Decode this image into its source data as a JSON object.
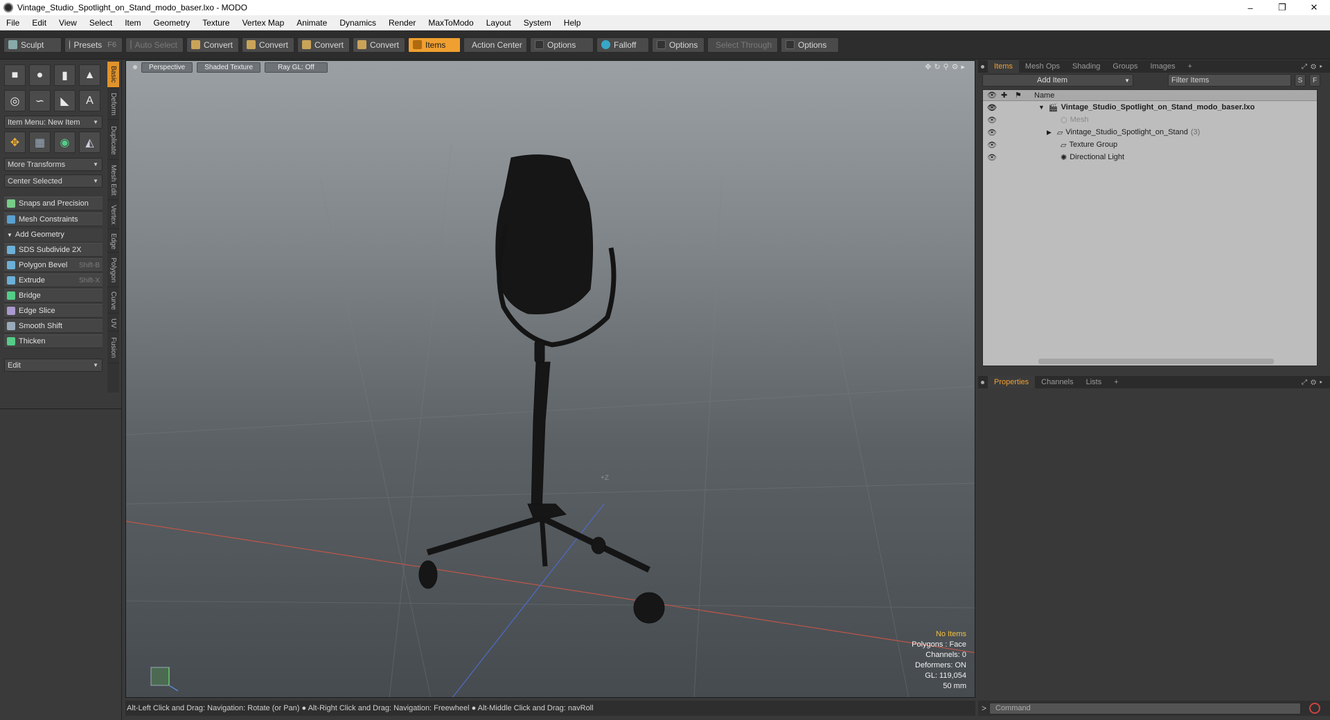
{
  "window": {
    "title": "Vintage_Studio_Spotlight_on_Stand_modo_baser.lxo - MODO",
    "controls": [
      "–",
      "❐",
      "✕"
    ]
  },
  "menu": [
    "File",
    "Edit",
    "View",
    "Select",
    "Item",
    "Geometry",
    "Texture",
    "Vertex Map",
    "Animate",
    "Dynamics",
    "Render",
    "MaxToModo",
    "Layout",
    "System",
    "Help"
  ],
  "toolbar": {
    "sculpt": "Sculpt",
    "presets": "Presets",
    "presets_key": "F6",
    "auto_select": "Auto Select",
    "convert1": "Convert",
    "convert2": "Convert",
    "convert3": "Convert",
    "convert4": "Convert",
    "items": "Items",
    "action_center": "Action Center",
    "options1": "Options",
    "falloff": "Falloff",
    "options2": "Options",
    "select_through": "Select Through",
    "options3": "Options"
  },
  "left": {
    "item_menu": "Item Menu: New Item",
    "more_transforms": "More Transforms",
    "center_selected": "Center Selected",
    "snaps": "Snaps and Precision",
    "mesh_constraints": "Mesh Constraints",
    "add_geometry": "Add Geometry",
    "tools": [
      {
        "label": "SDS Subdivide 2X",
        "key": ""
      },
      {
        "label": "Polygon Bevel",
        "key": "Shift-B"
      },
      {
        "label": "Extrude",
        "key": "Shift-X"
      },
      {
        "label": "Bridge",
        "key": ""
      },
      {
        "label": "Edge Slice",
        "key": ""
      },
      {
        "label": "Smooth Shift",
        "key": ""
      },
      {
        "label": "Thicken",
        "key": ""
      }
    ],
    "edit": "Edit",
    "vtabs": [
      "Basic",
      "Deform",
      "Duplicate",
      "Mesh Edit",
      "Vertex",
      "Edge",
      "Polygon",
      "Curve",
      "UV",
      "Fusion"
    ]
  },
  "viewport": {
    "perspective": "Perspective",
    "shading": "Shaded Texture",
    "raygl": "Ray GL: Off",
    "axis_label": "+Z",
    "stats": {
      "items": "No Items",
      "polygons": "Polygons : Face",
      "channels": "Channels: 0",
      "deformers": "Deformers: ON",
      "gl": "GL: 119,054",
      "scale": "50 mm"
    }
  },
  "status": "Alt-Left Click and Drag: Navigation: Rotate (or Pan) ● Alt-Right Click and Drag: Navigation: Freewheel ● Alt-Middle Click and Drag: navRoll",
  "right": {
    "tabs": [
      "Items",
      "Mesh Ops",
      "Shading",
      "Groups",
      "Images",
      "+"
    ],
    "add_item": "Add Item",
    "filter": "Filter Items",
    "s": "S",
    "f": "F",
    "col_name": "Name",
    "tree": [
      {
        "label": "Vintage_Studio_Spotlight_on_Stand_modo_baser.lxo",
        "count": ""
      },
      {
        "label": "Mesh",
        "count": ""
      },
      {
        "label": "Vintage_Studio_Spotlight_on_Stand",
        "count": "(3)"
      },
      {
        "label": "Texture Group",
        "count": ""
      },
      {
        "label": "Directional Light",
        "count": ""
      }
    ],
    "bottom_tabs": [
      "Properties",
      "Channels",
      "Lists",
      "+"
    ],
    "command_placeholder": "Command",
    "cmd_prompt": ">"
  }
}
